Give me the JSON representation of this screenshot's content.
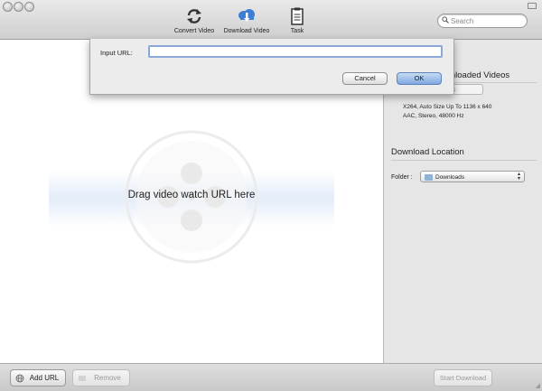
{
  "toolbar": {
    "buttons": [
      {
        "label": "Convert Video",
        "icon": "refresh-icon"
      },
      {
        "label": "Download Video",
        "icon": "cloud-download-icon"
      },
      {
        "label": "Task",
        "icon": "clipboard-icon"
      }
    ],
    "search_placeholder": "Search"
  },
  "sheet": {
    "input_label": "Input URL:",
    "input_value": "",
    "cancel_label": "Cancel",
    "ok_label": "OK"
  },
  "main": {
    "drop_text": "Drag video watch URL here"
  },
  "side": {
    "preset_title_visible": "wnloaded Videos",
    "preset_box_visible": "s",
    "info_line1": "X264, Auto Size Up To 1136 x 640",
    "info_line2": "AAC, Stereo, 48000 Hz",
    "location_title": "Download Location",
    "folder_label": "Folder :",
    "folder_value": "Downloads"
  },
  "bottom": {
    "add_label": "Add URL",
    "remove_label": "Remove",
    "start_label": "Start Download"
  },
  "colors": {
    "accent_blue": "#3d7fd6",
    "ok_button": "#7fa8e0",
    "drop_band": "#e6eefa"
  }
}
